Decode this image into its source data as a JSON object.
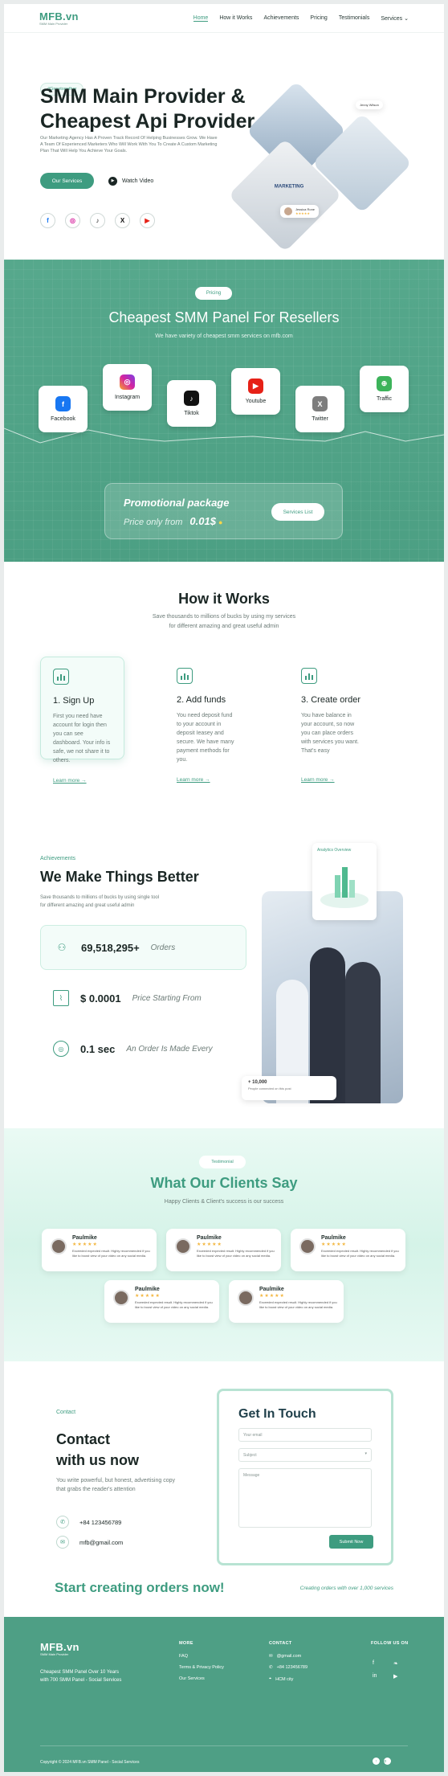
{
  "nav": {
    "logo": "MFB.vn",
    "logo_sub": "SMM Main Provider",
    "items": [
      "Home",
      "How it Works",
      "Achievements",
      "Pricing",
      "Testimonials",
      "Services"
    ]
  },
  "hero": {
    "badge": "#Growtogether",
    "title_line1": "SMM Main Provider &",
    "title_line2": "Cheapest Api Provider",
    "desc": "Our Marketing Agency Has A Proven Track Record Of Helping Businesses Grow. We Have A Team Of Experienced Marketers Who Will Work With You To Create A Custom Marketing Plan That Will Help You Achieve Your Goals.",
    "cta": "Our Services",
    "watch": "Watch Video",
    "card1_name": "Jenny Wilson",
    "card2_name": "Jessica Rone",
    "card2_stars": "★★★★★",
    "laptop_text": "MARKETING"
  },
  "pricing": {
    "badge": "Pricing",
    "title": "Cheapest SMM Panel For Resellers",
    "subtitle": "We have variety of cheapest smm services on mfb.com",
    "platforms": [
      "Facebook",
      "Instagram",
      "Tiktok",
      "Youtube",
      "Twitter",
      "Traffic"
    ],
    "promo_title": "Promotional package",
    "promo_price_label": "Price only from",
    "promo_price": "0.01$",
    "promo_button": "Services List"
  },
  "how": {
    "title": "How it Works",
    "subtitle_line1": "Save thousands to millions of bucks by using my services",
    "subtitle_line2": "for different amazing and great useful admin",
    "steps": [
      {
        "title": "1. Sign Up",
        "text": "First you need have account for login then you can see dashboard. Your info is safe, we not share it to others.",
        "link": "Learn more →"
      },
      {
        "title": "2. Add funds",
        "text": "You need deposit fund to your account in deposit Іeasey and secure. We have many payment methods for you.",
        "link": "Learn more →"
      },
      {
        "title": "3. Create order",
        "text": "You have balance in your account, so now you can place orders with services you want. That's easy",
        "link": "Learn more →"
      }
    ]
  },
  "achievements": {
    "label": "Achievements",
    "title": "We Make Things Better",
    "subtitle_line1": "Save thousands to millions of bucks by using single tool",
    "subtitle_line2": "for different amazing and great useful admin",
    "stats": [
      {
        "value": "69,518,295+",
        "label": "Orders"
      },
      {
        "value": "$ 0.0001",
        "label": "Price Starting From"
      },
      {
        "value": "0.1 sec",
        "label": "An Order Is Made Every"
      }
    ],
    "overview": "Analytics Overview",
    "bubble_value": "+ 10,000",
    "bubble_text": "People connected on this post"
  },
  "testimonials": {
    "badge": "Testimonial",
    "title": "What Our Clients Say",
    "subtitle": "Happy Clients & Client's success is our success",
    "items": [
      {
        "name": "Paulmike",
        "stars": "★★★★★",
        "text": "Exceeded expected result. Highly recommended if you like to boost view of your video on any social media."
      },
      {
        "name": "Paulmike",
        "stars": "★★★★★",
        "text": "Exceeded expected result. Highly recommended if you like to boost view of your video on any social media."
      },
      {
        "name": "Paulmike",
        "stars": "★★★★★",
        "text": "Exceeded expected result. Highly recommended if you like to boost view of your video on any social media."
      },
      {
        "name": "Paulmike",
        "stars": "★★★★★",
        "text": "Exceeded expected result. Highly recommended if you like to boost view of your video on any social media."
      },
      {
        "name": "Paulmike",
        "stars": "★★★★★",
        "text": "Exceeded expected result. Highly recommended if you like to boost view of your video on any social media."
      }
    ]
  },
  "contact": {
    "label": "Contact",
    "title_line1": "Contact",
    "title_line2": "with us now",
    "desc": "You write powerful, but honest, advertising copy that grabs the reader's attention",
    "phone": "+84 123456789",
    "email": "mfb@gmail.com",
    "form_title": "Get In Touch",
    "email_placeholder": "Your email",
    "subject_placeholder": "Subject",
    "message_placeholder": "Message",
    "submit": "Submit Now"
  },
  "cta": {
    "headline": "Start creating orders now!",
    "tagline": "Creating orders with over 1,000 services"
  },
  "footer": {
    "logo": "MFB.vn",
    "logo_sub": "SMM Main Provider",
    "desc": "Cheapest SMM Panel Over 10 Years with 700 SMM Panel - Social Services",
    "more_title": "MORE",
    "more": [
      "FAQ",
      "Terms & Privacy Policy",
      "Our Services"
    ],
    "contact_title": "CONTACT",
    "contact_email": "@gmail.com",
    "contact_phone": "+84 123456789",
    "contact_city": "HCM city",
    "follow_title": "FOLLOW US ON",
    "copyright": "Copyright © 2024 MFB.vn SMM Panel - Social Services",
    "back_to_top": "Back to top"
  },
  "colors": {
    "accent": "#3e9c80",
    "footer": "#4e9f85",
    "star": "#f3b63f"
  }
}
